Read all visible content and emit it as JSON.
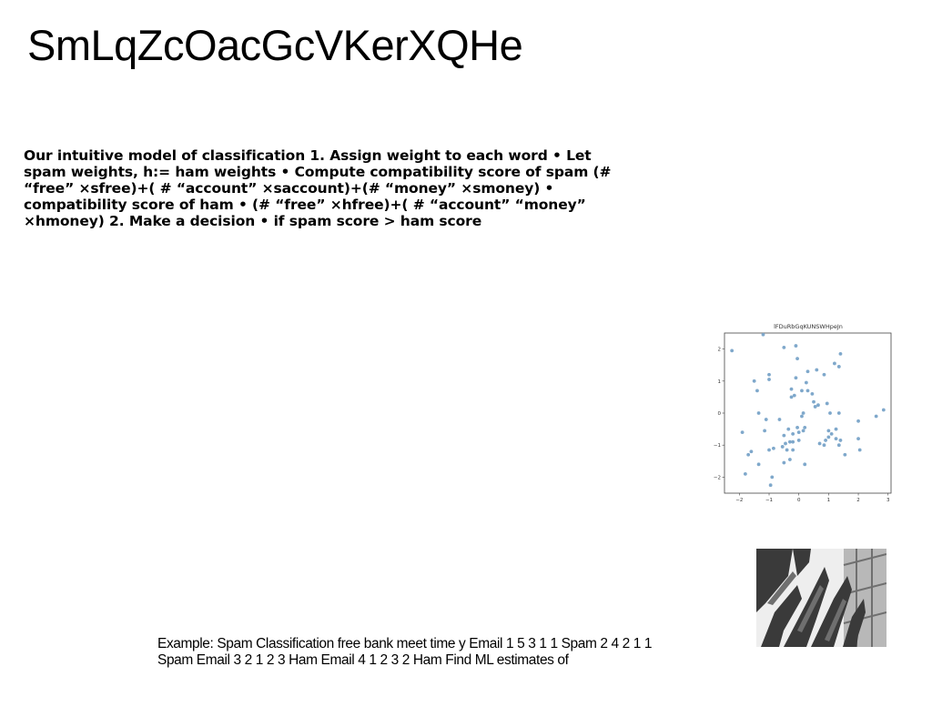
{
  "slide": {
    "title": "SmLqZcOacGcVKerXQHe",
    "body": "Our intuitive model of classification 1. Assign weight to each word • Let spam weights, h:= ham weights • Compute compatibility score of spam (# “free” ×sfree)+( # “account” ×saccount)+(# “money” ×smoney) • compatibility score of ham • (# “free” ×hfree)+( # “account” “money” ×hmoney) 2. Make a decision • if spam score > ham score",
    "example": "Example: Spam Classification free bank meet time y Email 1 5 3 1 1 Spam 2 4 2 1 1 Spam Email 3 2 1 2 3 Ham Email 4 1 2 3 2 Ham Find ML estimates of"
  },
  "chart_data": {
    "type": "scatter",
    "title": "lFDuRbGqKUNSWHpeJn",
    "xlim": [
      -2.5,
      3.1
    ],
    "ylim": [
      -2.5,
      2.5
    ],
    "xticks": [
      "−2",
      "−1",
      "0",
      "1",
      "2",
      "3"
    ],
    "yticks": [
      "2",
      "1",
      "0",
      "−1",
      "−2"
    ],
    "xtick_values": [
      -2,
      -1,
      0,
      1,
      2,
      3
    ],
    "ytick_values": [
      2,
      1,
      0,
      -1,
      -2
    ],
    "grid": false,
    "point_color": "#7fa8cb",
    "x": [
      -2.25,
      -1.2,
      -0.5,
      -0.1,
      -1.5,
      -0.05,
      0.3,
      0.6,
      1.4,
      -1.0,
      -1.4,
      -1.0,
      -0.25,
      -0.1,
      0.25,
      0.85,
      1.2,
      1.35,
      0.45,
      0.3,
      0.95,
      -1.35,
      -0.25,
      -0.15,
      0.1,
      0.5,
      1.05,
      1.35,
      -1.1,
      0.1,
      0.15,
      0.55,
      0.2,
      0.65,
      -1.15,
      -0.65,
      -0.35,
      -0.2,
      0.15,
      0.0,
      -0.05,
      1.0,
      1.25,
      2.0,
      2.6,
      2.85,
      -0.3,
      -0.5,
      -0.45,
      -0.2,
      0.0,
      1.25,
      1.4,
      1.55,
      -0.2,
      -1.0,
      -0.85,
      -0.55,
      -0.4,
      0.2,
      0.7,
      1.35,
      -1.7,
      -1.6,
      -0.3,
      -0.5,
      1.0,
      1.1,
      0.9,
      2.0,
      2.05,
      -1.9,
      -1.8,
      -1.35,
      -0.9,
      -0.95,
      0.85
    ],
    "y": [
      1.95,
      2.45,
      2.05,
      2.1,
      1.0,
      1.7,
      1.3,
      1.35,
      1.85,
      1.05,
      0.7,
      1.2,
      0.5,
      1.1,
      0.95,
      1.2,
      1.55,
      1.45,
      0.6,
      0.7,
      0.3,
      0.0,
      0.75,
      0.55,
      0.7,
      0.35,
      0.0,
      0.0,
      -0.2,
      -0.1,
      0.0,
      0.2,
      -0.45,
      0.25,
      -0.55,
      -0.2,
      -0.5,
      -0.65,
      -0.55,
      -0.6,
      -0.45,
      -0.55,
      -0.5,
      -0.25,
      -0.1,
      0.1,
      -0.9,
      -0.7,
      -0.95,
      -0.9,
      -0.85,
      -0.8,
      -0.85,
      -1.3,
      -1.15,
      -1.15,
      -1.1,
      -1.05,
      -1.15,
      -1.6,
      -0.95,
      -1.0,
      -1.3,
      -1.2,
      -1.45,
      -1.55,
      -0.75,
      -0.65,
      -0.85,
      -0.8,
      -1.15,
      -0.6,
      -1.9,
      -1.6,
      -2.0,
      -2.25,
      -1.0
    ]
  },
  "photo": {
    "icon": "plant-photo",
    "colors": {
      "bg": "#eeeeee",
      "dark": "#3a3a3a",
      "mid": "#6f6f6f",
      "light": "#b8b8b8"
    }
  }
}
